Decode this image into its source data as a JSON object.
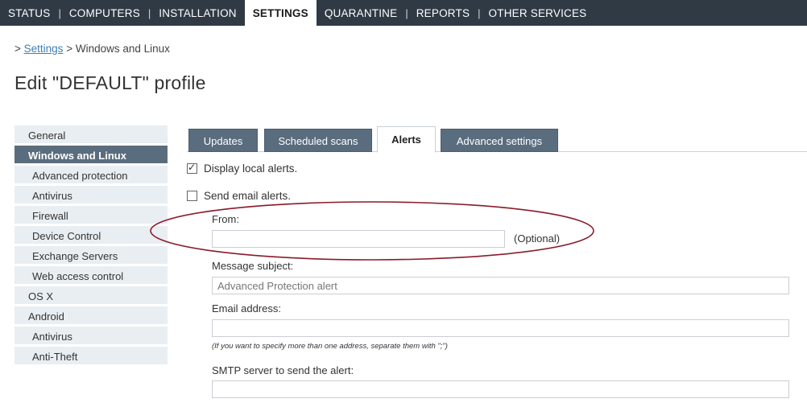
{
  "topnav": {
    "items": [
      "STATUS",
      "COMPUTERS",
      "INSTALLATION",
      "SETTINGS",
      "QUARANTINE",
      "REPORTS",
      "OTHER SERVICES"
    ],
    "separator": "|"
  },
  "breadcrumb": {
    "prefix": ">",
    "link": "Settings",
    "current": "> Windows and Linux"
  },
  "page_title": "Edit \"DEFAULT\" profile",
  "sidebar": {
    "items": [
      {
        "label": "General"
      },
      {
        "label": "Windows and Linux"
      },
      {
        "label": "Advanced protection"
      },
      {
        "label": "Antivirus"
      },
      {
        "label": "Firewall"
      },
      {
        "label": "Device Control"
      },
      {
        "label": "Exchange Servers"
      },
      {
        "label": "Web access control"
      },
      {
        "label": "OS X"
      },
      {
        "label": "Android"
      },
      {
        "label": "Antivirus"
      },
      {
        "label": "Anti-Theft"
      }
    ]
  },
  "tabs": [
    "Updates",
    "Scheduled scans",
    "Alerts",
    "Advanced settings"
  ],
  "form": {
    "display_local_alerts": {
      "label": "Display local alerts.",
      "checked": true
    },
    "send_email_alerts": {
      "label": "Send email alerts.",
      "checked": false
    },
    "from": {
      "label": "From:",
      "value": "",
      "note": "(Optional)"
    },
    "subject": {
      "label": "Message subject:",
      "value": "Advanced Protection alert"
    },
    "email": {
      "label": "Email address:",
      "value": "",
      "hint": "(If you want to specify more than one address, separate them with \";\")"
    },
    "smtp": {
      "label": "SMTP server to send the alert:",
      "value": ""
    }
  },
  "colors": {
    "nav_bg": "#2f3a45",
    "sidebar_bg": "#e9eef2",
    "sidebar_active": "#5a6d7e",
    "tab_bg": "#5a6d7e",
    "link": "#3b7fb8",
    "highlight_ellipse": "#8b1a2a"
  }
}
